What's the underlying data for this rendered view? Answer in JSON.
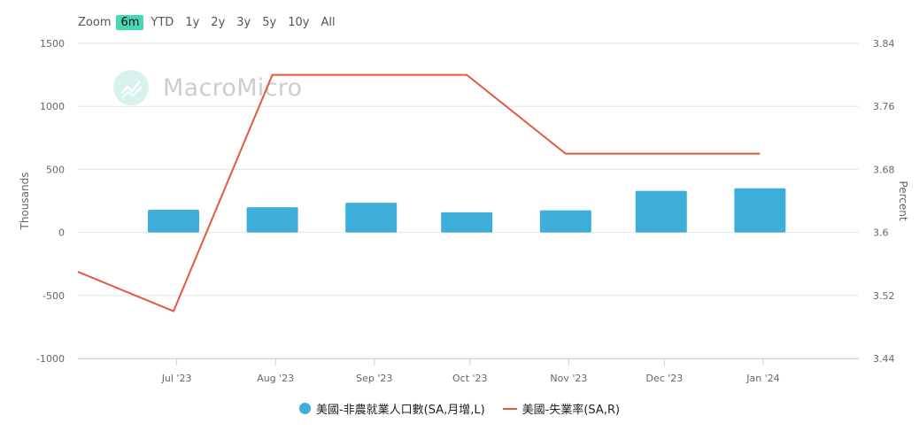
{
  "zoom": {
    "label": "Zoom",
    "options": [
      "6m",
      "YTD",
      "1y",
      "2y",
      "3y",
      "5y",
      "10y",
      "All"
    ],
    "selected": "6m"
  },
  "watermark": {
    "text": "MacroMicro"
  },
  "colors": {
    "bar": "#3dadda",
    "line": "#e2593e",
    "accent": "#47d6b6",
    "grid": "#e6e6e6"
  },
  "chart_data": {
    "type": "bar",
    "categories": [
      "Jul '23",
      "Aug '23",
      "Sep '23",
      "Oct '23",
      "Nov '23",
      "Dec '23",
      "Jan '24"
    ],
    "series": [
      {
        "name": "美國-非農就業人口數(SA,月增,L)",
        "type": "bar",
        "axis": "left",
        "x": [
          "2023-06-30",
          "2023-07-31",
          "2023-08-31",
          "2023-09-30",
          "2023-10-31",
          "2023-11-30",
          "2023-12-31"
        ],
        "values": [
          180,
          200,
          235,
          160,
          175,
          330,
          350
        ]
      },
      {
        "name": "美國-失業率(SA,R)",
        "type": "line",
        "axis": "right",
        "x": [
          "2023-05-31",
          "2023-06-30",
          "2023-07-31",
          "2023-08-31",
          "2023-09-30",
          "2023-10-31",
          "2023-11-30",
          "2023-12-31"
        ],
        "values": [
          3.55,
          3.5,
          3.8,
          3.8,
          3.8,
          3.7,
          3.7,
          3.7
        ]
      }
    ],
    "ylabel": "Thousands",
    "y2label": "Percent",
    "ylim": [
      -1000,
      1500
    ],
    "y2lim": [
      3.44,
      3.84
    ],
    "yticks": [
      1500,
      1000,
      500,
      0,
      -500,
      -1000
    ],
    "y2ticks": [
      3.84,
      3.76,
      3.68,
      3.6,
      3.52,
      3.44
    ],
    "xlim": [
      "2023-05-31",
      "2024-01-31"
    ],
    "xticks": [
      "2023-07-01",
      "2023-08-01",
      "2023-09-01",
      "2023-10-01",
      "2023-11-01",
      "2023-12-01",
      "2024-01-01"
    ],
    "grid": true,
    "legend": "bottom"
  }
}
